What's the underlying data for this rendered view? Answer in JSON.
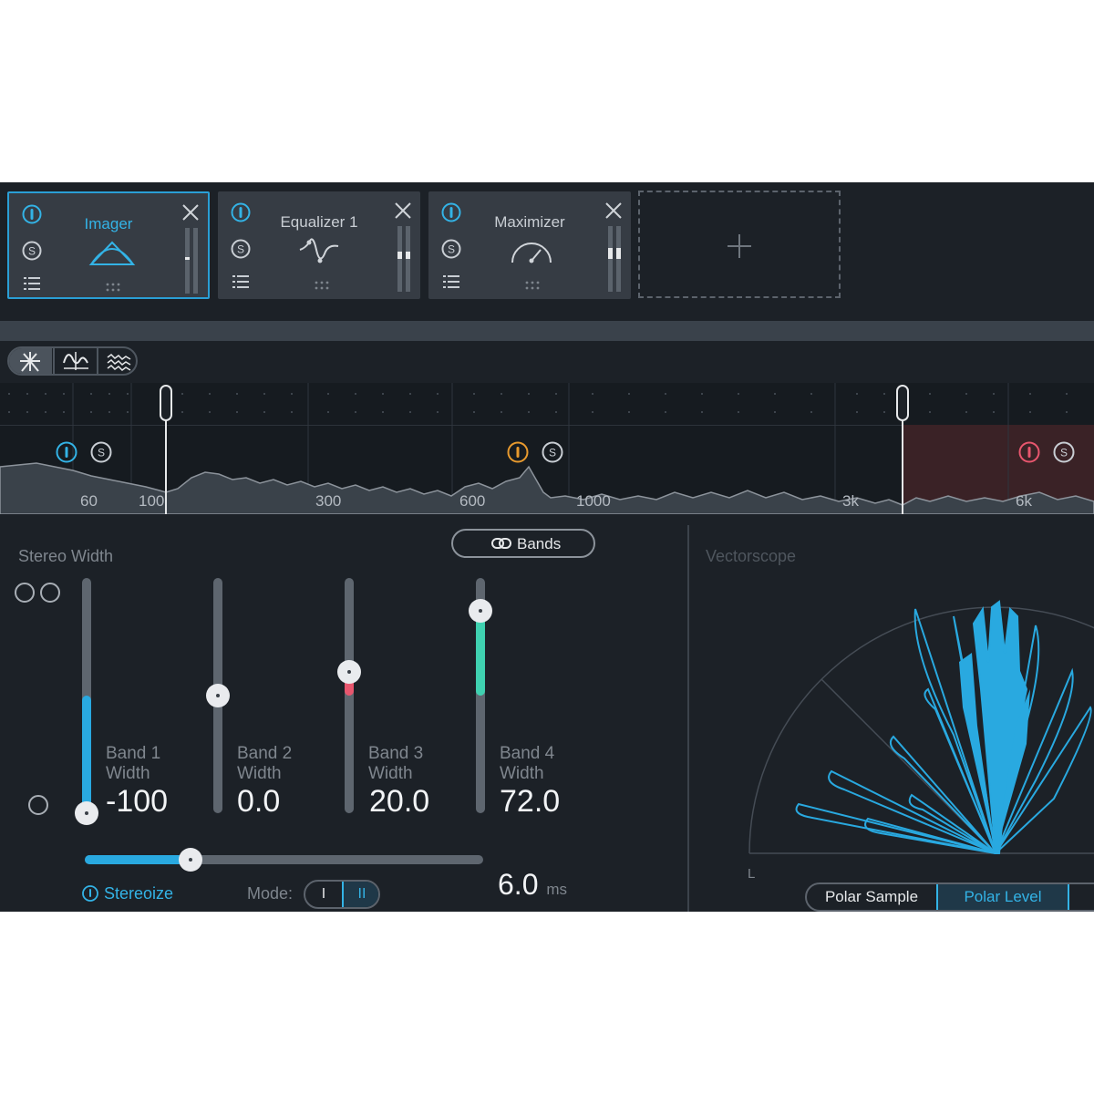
{
  "modules": [
    {
      "name": "Imager",
      "active": true
    },
    {
      "name": "Equalizer 1",
      "active": false
    },
    {
      "name": "Maximizer",
      "active": false
    }
  ],
  "add_module_symbol": "+",
  "spectrum": {
    "freq_labels": [
      "60",
      "100",
      "300",
      "600",
      "1000",
      "3k",
      "6k"
    ]
  },
  "controls": {
    "title": "Stereo Width",
    "bands_button": "Bands",
    "bands": [
      {
        "name": "Band 1",
        "sub": "Width",
        "value": "-100",
        "level": -100,
        "color": "#29a9e0"
      },
      {
        "name": "Band 2",
        "sub": "Width",
        "value": "0.0",
        "level": 0,
        "color": "#29a9e0"
      },
      {
        "name": "Band 3",
        "sub": "Width",
        "value": "20.0",
        "level": 20,
        "color": "#e8566e"
      },
      {
        "name": "Band 4",
        "sub": "Width",
        "value": "72.0",
        "level": 72,
        "color": "#3fd1b0"
      }
    ],
    "stereoize_label": "Stereoize",
    "mode_label": "Mode:",
    "mode_options": [
      "I",
      "II"
    ],
    "mode_selected": "II",
    "delay_value": "6.0",
    "delay_unit": "ms"
  },
  "vectorscope": {
    "title": "Vectorscope",
    "left_label": "L",
    "tabs": [
      "Polar Sample",
      "Polar Level"
    ],
    "selected_tab": "Polar Level"
  },
  "colors": {
    "accent": "#29a9e0",
    "band3": "#e8566e",
    "band4": "#3fd1b0",
    "solo_orange": "#e89a2e"
  }
}
